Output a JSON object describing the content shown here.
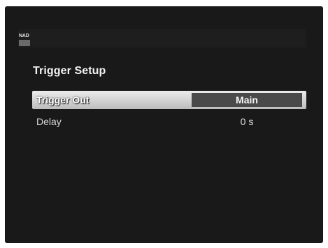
{
  "header": {
    "logo_text": "NAD"
  },
  "page": {
    "title": "Trigger Setup"
  },
  "settings": [
    {
      "label": "Trigger Out",
      "value": "Main",
      "selected": true
    },
    {
      "label": "Delay",
      "value": "0 s",
      "selected": false
    }
  ]
}
